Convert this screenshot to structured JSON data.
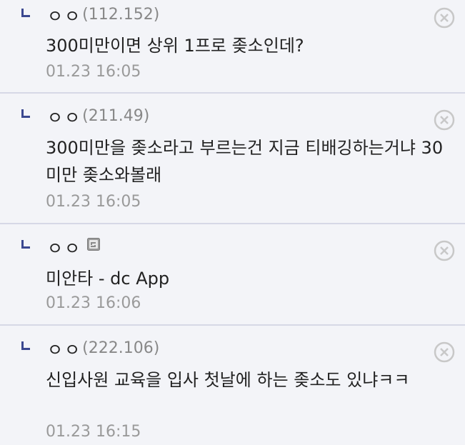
{
  "comments": [
    {
      "nick": "ㅇㅇ",
      "ip": "(112.152)",
      "text": "300미만이면 상위 1프로 좆소인데?",
      "date": "01.23 16:05"
    },
    {
      "nick": "ㅇㅇ",
      "ip": "(211.49)",
      "text": "300미만을 좆소라고 부르는건 지금 티배깅하는거냐 30미만 좆소와볼래",
      "date": "01.23 16:05"
    },
    {
      "nick": "ㅇㅇ",
      "ip": "",
      "app_badge": "mobile-app-badge-icon",
      "text": "미안타 - dc App",
      "date": "01.23 16:06"
    },
    {
      "nick": "ㅇㅇ",
      "ip": "(222.106)",
      "text": "신입사원 교육을 입사 첫날에 하는 좆소도 있냐ㅋㅋ",
      "date": "01.23 16:15"
    }
  ],
  "colors": {
    "background": "#f3f4f8",
    "divider": "#d6d8e6",
    "reply_icon": "#3b4890",
    "meta_text": "#9a9a9a",
    "delete_icon": "#c8c8c8"
  },
  "icons": {
    "reply": "reply-arrow-icon",
    "delete": "delete-circle-x-icon"
  }
}
